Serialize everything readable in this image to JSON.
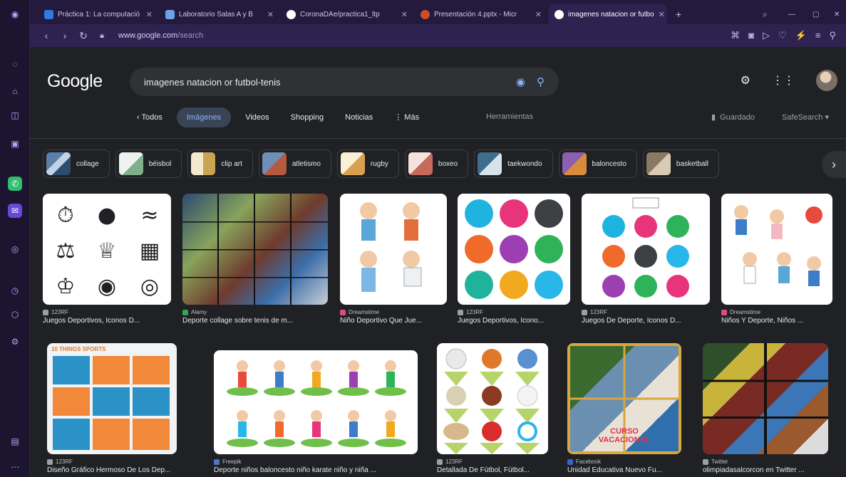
{
  "tabs": [
    {
      "label": "Práctica 1: La computació",
      "color": "#2d7be5"
    },
    {
      "label": "Laboratorio Salas A y B",
      "color": "#6ca3e8"
    },
    {
      "label": "CoronaDAe/practica1_ltp",
      "color": "#ffffff"
    },
    {
      "label": "Presentación 4.pptx - Micr",
      "color": "#d04d2a"
    },
    {
      "label": "imagenes natacion or futbo",
      "color": "#ffffff"
    }
  ],
  "url": {
    "host": "www.google.com",
    "path": "/search"
  },
  "logo": "Google",
  "search": {
    "query": "imagenes natacion or futbol-tenis"
  },
  "filters": [
    "‹ Todos",
    "Imágenes",
    "Videos",
    "Shopping",
    "Noticias",
    "⋮ Más"
  ],
  "tools_label": "Herramientas",
  "saved_label": "Guardado",
  "safesearch_label": "SafeSearch ▾",
  "related": [
    {
      "label": "collage",
      "color": "#5a7fa8"
    },
    {
      "label": "béisbol",
      "color": "#7fb08a"
    },
    {
      "label": "clip art",
      "color": "#c9a452"
    },
    {
      "label": "atletismo",
      "color": "#6f8fb7"
    },
    {
      "label": "rugby",
      "color": "#d9a14f"
    },
    {
      "label": "boxeo",
      "color": "#c76a5e"
    },
    {
      "label": "taekwondo",
      "color": "#3f6e8c"
    },
    {
      "label": "baloncesto",
      "color": "#8c5fb0"
    },
    {
      "label": "basketball",
      "color": "#8a7a62"
    }
  ],
  "results": [
    {
      "source": "123RF",
      "caption": "Juegos Deportivos, Iconos D...",
      "srccolor": "#9aa0a6"
    },
    {
      "source": "Alamy",
      "caption": "Deporte collage sobre tenis de m...",
      "srccolor": "#2fa84f"
    },
    {
      "source": "Dreamstime",
      "caption": "Niño Deportivo Que Jue...",
      "srccolor": "#e04a86"
    },
    {
      "source": "123RF",
      "caption": "Juegos Deportivos, Icono...",
      "srccolor": "#9aa0a6"
    },
    {
      "source": "123RF",
      "caption": "Juegos De Deporte, Iconos D...",
      "srccolor": "#9aa0a6"
    },
    {
      "source": "Dreamstime",
      "caption": "Niños Y Deporte, Niños ...",
      "srccolor": "#e04a86"
    },
    {
      "source": "123RF",
      "caption": "Diseño Gráfico Hermoso De Los Dep...",
      "srccolor": "#9aa0a6"
    },
    {
      "source": "Freepik",
      "caption": "Deporte niños baloncesto niño karate niño y niña ...",
      "srccolor": "#4a78c9"
    },
    {
      "source": "123RF",
      "caption": "Detallada De Fútbol, Fútbol...",
      "srccolor": "#9aa0a6"
    },
    {
      "source": "Facebook",
      "caption": "Unidad Educativa Nuevo Fu...",
      "srccolor": "#3b63c4"
    },
    {
      "source": "Twitter",
      "caption": "olimpiadasalcorcon en Twitter ...",
      "srccolor": "#9aa0a6"
    }
  ],
  "vacation_text": "CURSO VACACIONAL",
  "poster_text": "10 THINGS SPORTS",
  "colors": {
    "accent": "#8ab4f8",
    "bg": "#202124",
    "sidebar": "#1b1530",
    "chrome": "#2d2250"
  }
}
